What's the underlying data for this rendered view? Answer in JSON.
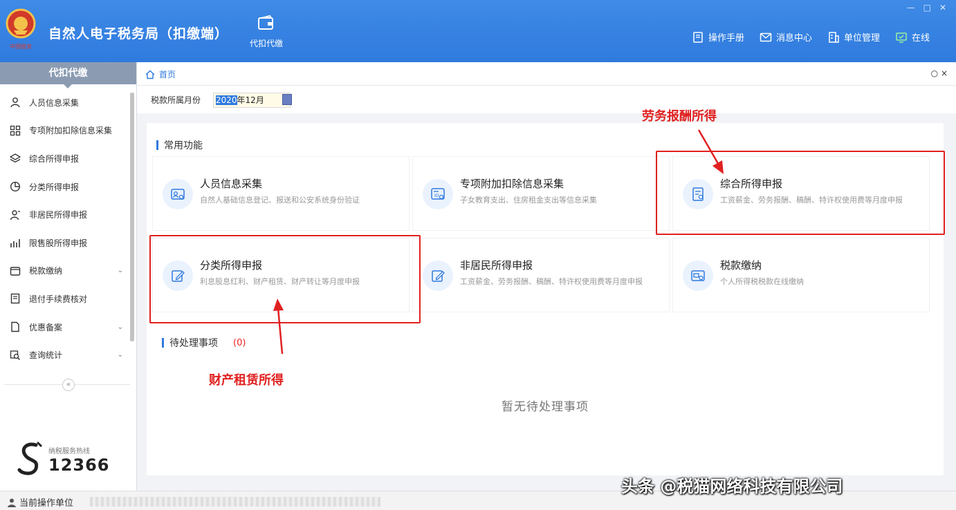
{
  "header": {
    "app_title": "自然人电子税务局（扣缴端）",
    "module_label": "代扣代缴",
    "actions": [
      {
        "label": "操作手册",
        "icon": "book-icon"
      },
      {
        "label": "消息中心",
        "icon": "mail-icon"
      },
      {
        "label": "单位管理",
        "icon": "building-icon"
      },
      {
        "label": "在线",
        "icon": "online-icon"
      }
    ],
    "window_controls": [
      "—",
      "□",
      "✕"
    ]
  },
  "sidebar": {
    "title": "代扣代缴",
    "items": [
      {
        "label": "人员信息采集",
        "icon": "person-icon",
        "expandable": false
      },
      {
        "label": "专项附加扣除信息采集",
        "icon": "apps-icon",
        "expandable": false
      },
      {
        "label": "综合所得申报",
        "icon": "layers-icon",
        "expandable": false
      },
      {
        "label": "分类所得申报",
        "icon": "pie-icon",
        "expandable": false
      },
      {
        "label": "非居民所得申报",
        "icon": "person-outline-icon",
        "expandable": false
      },
      {
        "label": "限售股所得申报",
        "icon": "bar-chart-icon",
        "expandable": false
      },
      {
        "label": "税款缴纳",
        "icon": "wallet-icon",
        "expandable": true
      },
      {
        "label": "退付手续费核对",
        "icon": "document-icon",
        "expandable": false
      },
      {
        "label": "优惠备案",
        "icon": "file-icon",
        "expandable": true
      },
      {
        "label": "查询统计",
        "icon": "search-stat-icon",
        "expandable": true
      }
    ],
    "collapse_symbol": "«",
    "hotline_caption": "纳税服务热线",
    "hotline_number": "12366"
  },
  "main": {
    "tab_home": "首页",
    "tab_close": "○ ×",
    "filter_label": "税款所属月份",
    "month_selected": "2020",
    "month_rest": "年12月",
    "common_title": "常用功能",
    "cards": [
      {
        "title": "人员信息采集",
        "desc": "自然人基础信息登记、报送和公安系统身份验证",
        "icon": "person-card-icon"
      },
      {
        "title": "专项附加扣除信息采集",
        "desc": "子女教育支出、住房租金支出等信息采集",
        "icon": "id-card-icon"
      },
      {
        "title": "综合所得申报",
        "desc": "工资薪金、劳务报酬、稿酬、特许权使用费等月度申报",
        "icon": "form-icon"
      },
      {
        "title": "分类所得申报",
        "desc": "利息股息红利、财产租赁、财产转让等月度申报",
        "icon": "edit-icon"
      },
      {
        "title": "非居民所得申报",
        "desc": "工资薪金、劳务报酬、稿酬、特许权使用费等月度申报",
        "icon": "edit-icon"
      },
      {
        "title": "税款缴纳",
        "desc": "个人所得税税款在线缴纳",
        "icon": "payment-icon"
      }
    ],
    "pending_title": "待处理事项",
    "pending_count": "(0)",
    "empty_text": "暂无待处理事项"
  },
  "annotations": {
    "label_top": "劳务报酬所得",
    "label_bottom": "财产租赁所得"
  },
  "statusbar": {
    "label": "当前操作单位"
  },
  "watermark": "头条 @税猫网络科技有限公司",
  "colors": {
    "header_blue": "#2f7ade",
    "annotation_red": "#e02020",
    "accent_blue": "#2f7ade"
  }
}
